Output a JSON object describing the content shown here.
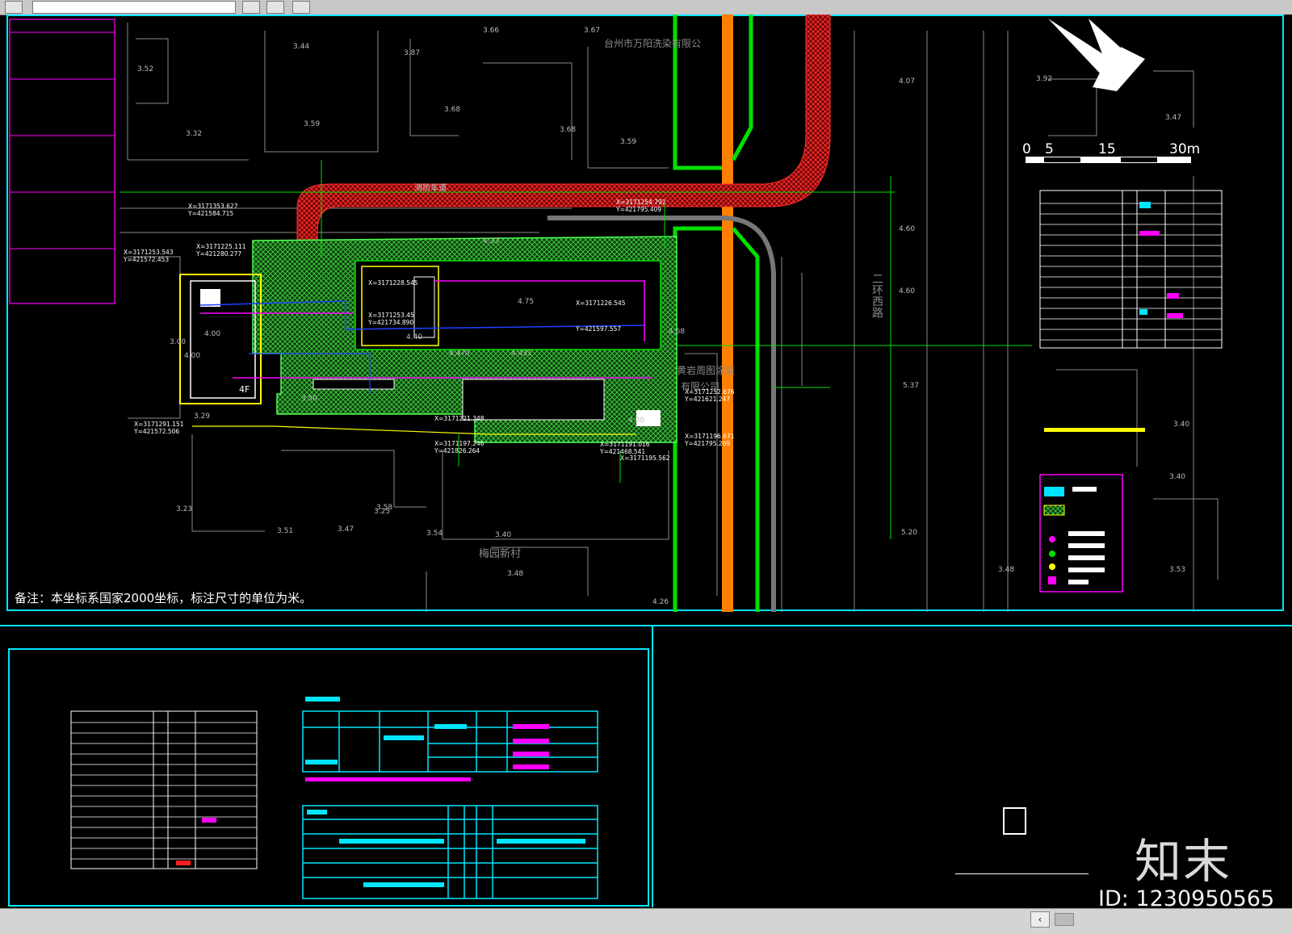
{
  "toolbar": {
    "buttons": [
      "",
      "",
      "",
      ""
    ]
  },
  "labels": {
    "company_top": "台州市万阳洗染有限公",
    "road_name": "二环西路",
    "village": "梅园新村",
    "company_mid": "黄岩周图涂装",
    "company_mid2": "有限公司",
    "fire_lane": "消防车道",
    "building_floors": "4F",
    "scale_0": "0",
    "scale_5": "5",
    "scale_15": "15",
    "scale_30": "30m"
  },
  "elevations": [
    "3.66",
    "3.67",
    "3.44",
    "3.87",
    "3.52",
    "3.32",
    "3.59",
    "3.68",
    "3.68",
    "3.59",
    "4.07",
    "4.60",
    "4.60",
    "3.92",
    "3.47",
    "5.37",
    "5.20",
    "3.47",
    "3.54",
    "3.40",
    "3.58",
    "3.51",
    "3.48",
    "3.40",
    "3.53",
    "3.23",
    "4.26",
    "4.00",
    "3.00",
    "3.29",
    "4.75",
    "4.33",
    "4.431",
    "4.470",
    "4.68",
    "4.40",
    "3.50",
    "4.00",
    "3.25",
    "4.00",
    "3.48",
    "3.40"
  ],
  "coords": [
    "X=3171353.627",
    "Y=421584.715",
    "X=3171225.111",
    "Y=421280.277",
    "X=3171253.543",
    "Y=421572.453",
    "X=3171254.792",
    "Y=421795.409",
    "X=3171228.545",
    "X=3171253.45",
    "Y=421734.890",
    "X=3171226.545",
    "Y=421597.557",
    "X=3171291.151",
    "Y=421572.506",
    "X=3171221.348",
    "X=3171197.246",
    "Y=421826.264",
    "X=3171191.016",
    "Y=421468.541",
    "X=3171195.562",
    "X=3171196.671",
    "Y=421795.269",
    "X=3171252.676",
    "Y=421621.247"
  ],
  "note": "备注：本坐标系国家2000坐标，标注尺寸的单位为米。",
  "watermark": {
    "brand": "知末",
    "id": "ID: 1230950565"
  },
  "colors": {
    "background": "#000000",
    "grid": "#8a8a8a",
    "road_green": "#00e000",
    "road_orange": "#ff7f00",
    "fire_lane": "#e02020",
    "vegetation": "#30c030",
    "yellow": "#ffff00",
    "cyan": "#00e5ff",
    "magenta": "#ff00ff",
    "blue": "#2040ff",
    "white": "#ffffff"
  }
}
